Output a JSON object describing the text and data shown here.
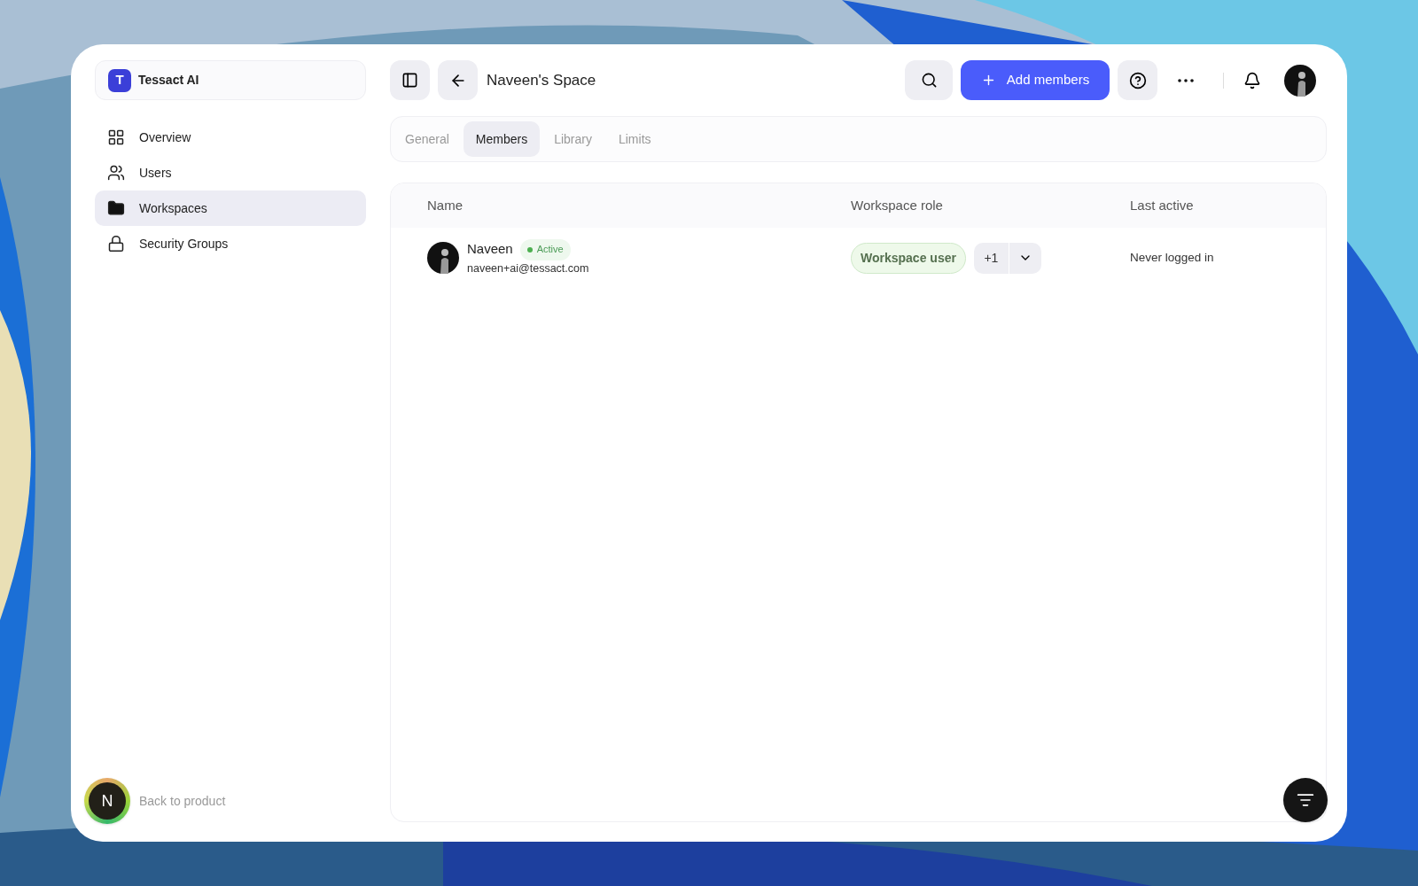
{
  "workspace": {
    "initial": "T",
    "name": "Tessact AI"
  },
  "sidebar": {
    "items": [
      {
        "kind": "grid",
        "label": "Overview",
        "selected": false
      },
      {
        "kind": "users",
        "label": "Users",
        "selected": false
      },
      {
        "kind": "folder",
        "label": "Workspaces",
        "selected": true
      },
      {
        "kind": "lock",
        "label": "Security Groups",
        "selected": false
      }
    ],
    "footer": {
      "initial": "N",
      "label": "Back to product"
    }
  },
  "header": {
    "title": "Naveen's Space",
    "add_button": "Add members"
  },
  "tabs": [
    {
      "label": "General",
      "selected": false
    },
    {
      "label": "Members",
      "selected": true
    },
    {
      "label": "Library",
      "selected": false
    },
    {
      "label": "Limits",
      "selected": false
    }
  ],
  "table": {
    "columns": [
      "Name",
      "Workspace role",
      "Last active"
    ],
    "rows": [
      {
        "name": "Naveen",
        "status": "Active",
        "email": "naveen+ai@tessact.com",
        "role": "Workspace user",
        "extra_roles": "+1",
        "last_active": "Never logged in"
      }
    ]
  }
}
